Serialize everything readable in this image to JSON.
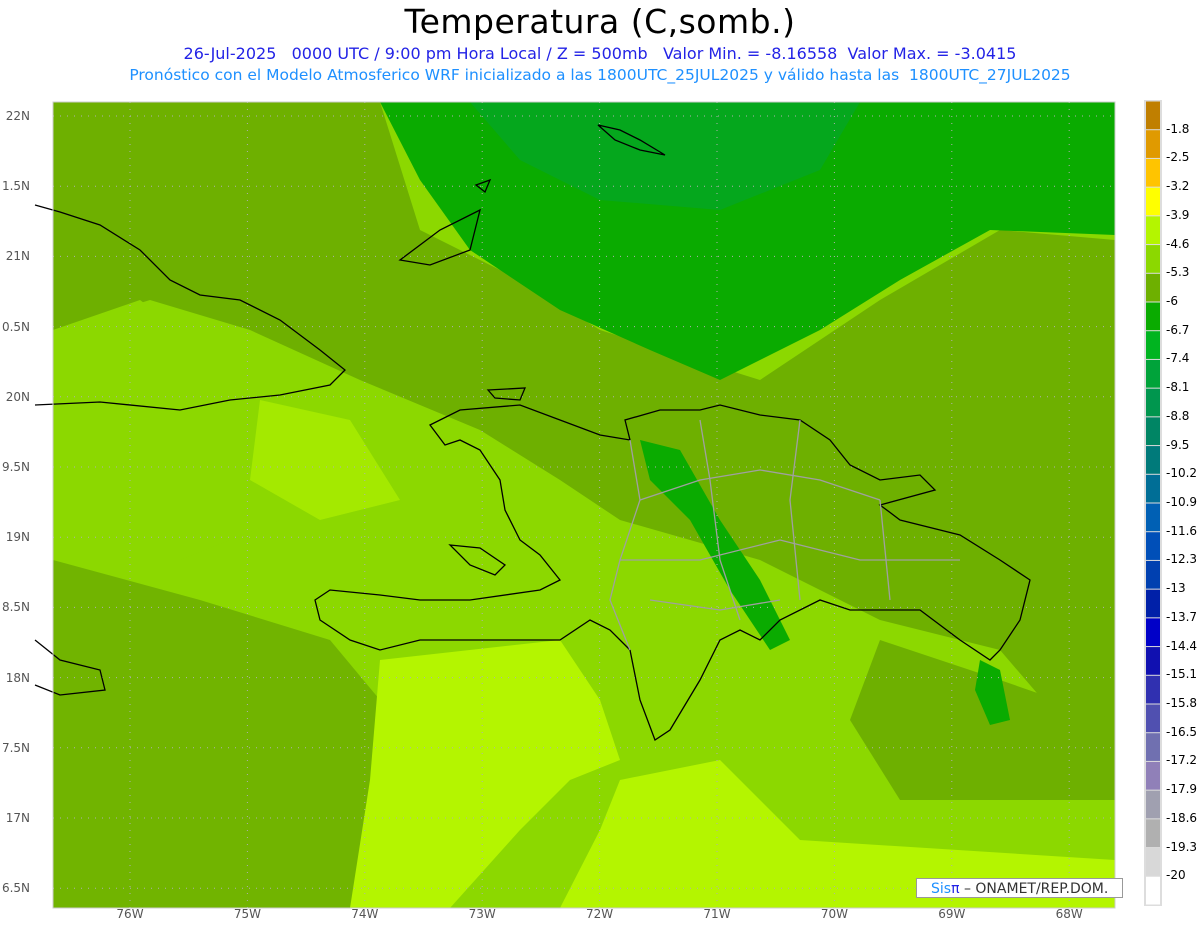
{
  "header": {
    "title": "Temperatura (C,somb.)",
    "subtitle1": "26-Jul-2025   0000 UTC / 9:00 pm Hora Local / Z = 500mb   Valor Min. = -8.16558  Valor Max. = -3.0415",
    "subtitle2": "Pronóstico con el Modelo Atmosferico WRF inicializado a las 1800UTC_25JUL2025 y válido hasta las  1800UTC_27JUL2025"
  },
  "axes": {
    "lat_labels": [
      "22N",
      "1.5N",
      "21N",
      "0.5N",
      "20N",
      "9.5N",
      "19N",
      "8.5N",
      "18N",
      "7.5N",
      "17N",
      "6.5N"
    ],
    "lon_labels": [
      "76W",
      "75W",
      "74W",
      "73W",
      "72W",
      "71W",
      "70W",
      "69W",
      "68W"
    ]
  },
  "colorbar": {
    "labels": [
      "-1.8",
      "-2.5",
      "-3.2",
      "-3.9",
      "-4.6",
      "-5.3",
      "-6",
      "-6.7",
      "-7.4",
      "-8.1",
      "-8.8",
      "-9.5",
      "-10.2",
      "-10.9",
      "-11.6",
      "-12.3",
      "-13",
      "-13.7",
      "-14.4",
      "-15.1",
      "-15.8",
      "-16.5",
      "-17.2",
      "-17.9",
      "-18.6",
      "-19.3",
      "-20"
    ],
    "colors": [
      "#c07f00",
      "#e09a00",
      "#ffc400",
      "#ffff00",
      "#b4f500",
      "#8cd800",
      "#6eb000",
      "#0aab00",
      "#00b420",
      "#00a33a",
      "#00964e",
      "#008564",
      "#007a7a",
      "#006e96",
      "#0060b4",
      "#004fb8",
      "#0040b0",
      "#0020a8",
      "#0000c8",
      "#1010b0",
      "#3030b0",
      "#5050b0",
      "#7070b0",
      "#9080b8",
      "#a0a0b0",
      "#b0b0b0",
      "#d8d8d8",
      "#ffffff"
    ]
  },
  "credit": {
    "sis": "Sis",
    "pi": "π",
    "text": " – ONAMET/REP.DOM."
  }
}
